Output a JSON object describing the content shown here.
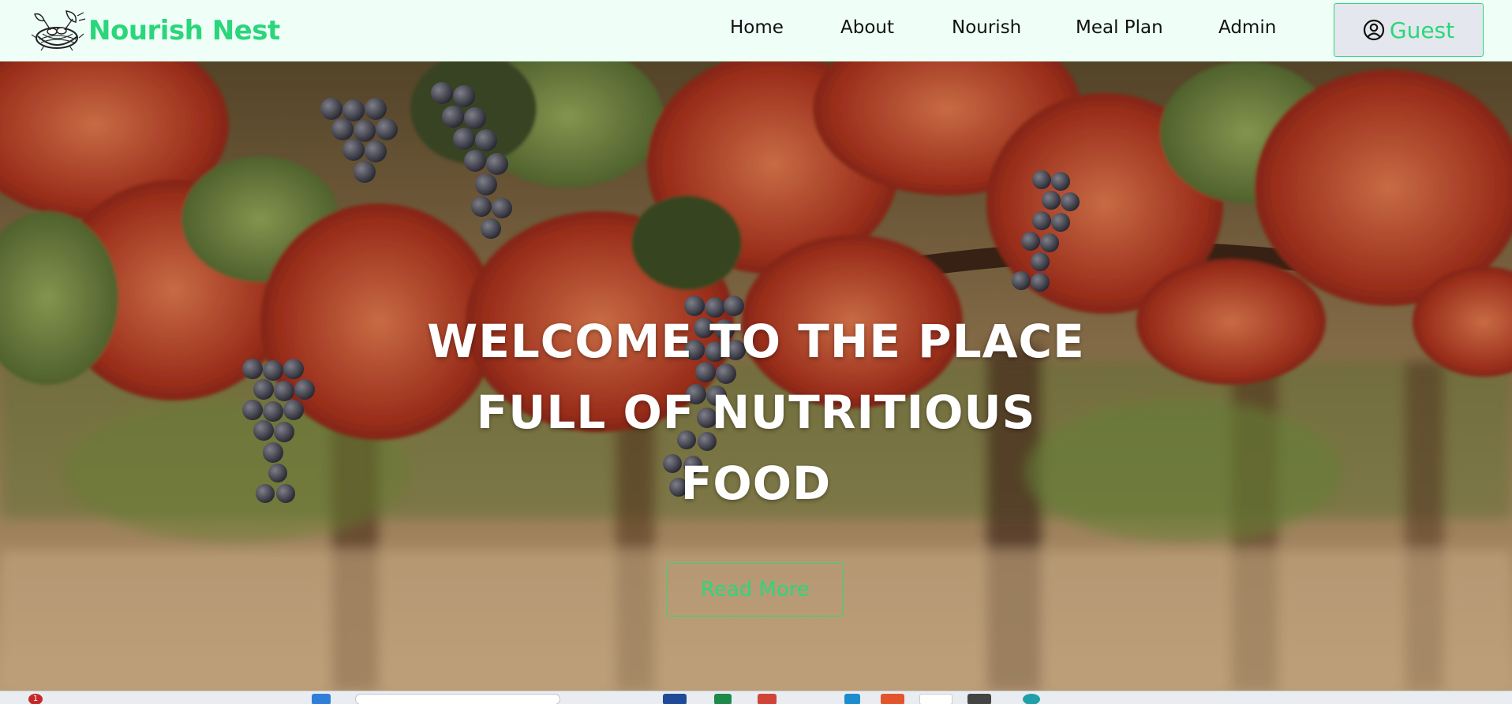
{
  "brand": {
    "name": "Nourish Nest",
    "accent_color": "#2bd67b"
  },
  "nav": {
    "items": [
      {
        "label": "Home"
      },
      {
        "label": "About"
      },
      {
        "label": "Nourish"
      },
      {
        "label": "Meal Plan"
      },
      {
        "label": "Admin"
      }
    ],
    "guest_label": "Guest",
    "guest_icon": "user-circle-icon"
  },
  "hero": {
    "title_lines": [
      "WELCOME TO THE PLACE",
      "FULL OF NUTRITIOUS",
      "FOOD"
    ],
    "read_more_label": "Read More",
    "background": "grapevine-autumn-leaves-photo"
  },
  "taskbar": {
    "notification_count": "1"
  }
}
